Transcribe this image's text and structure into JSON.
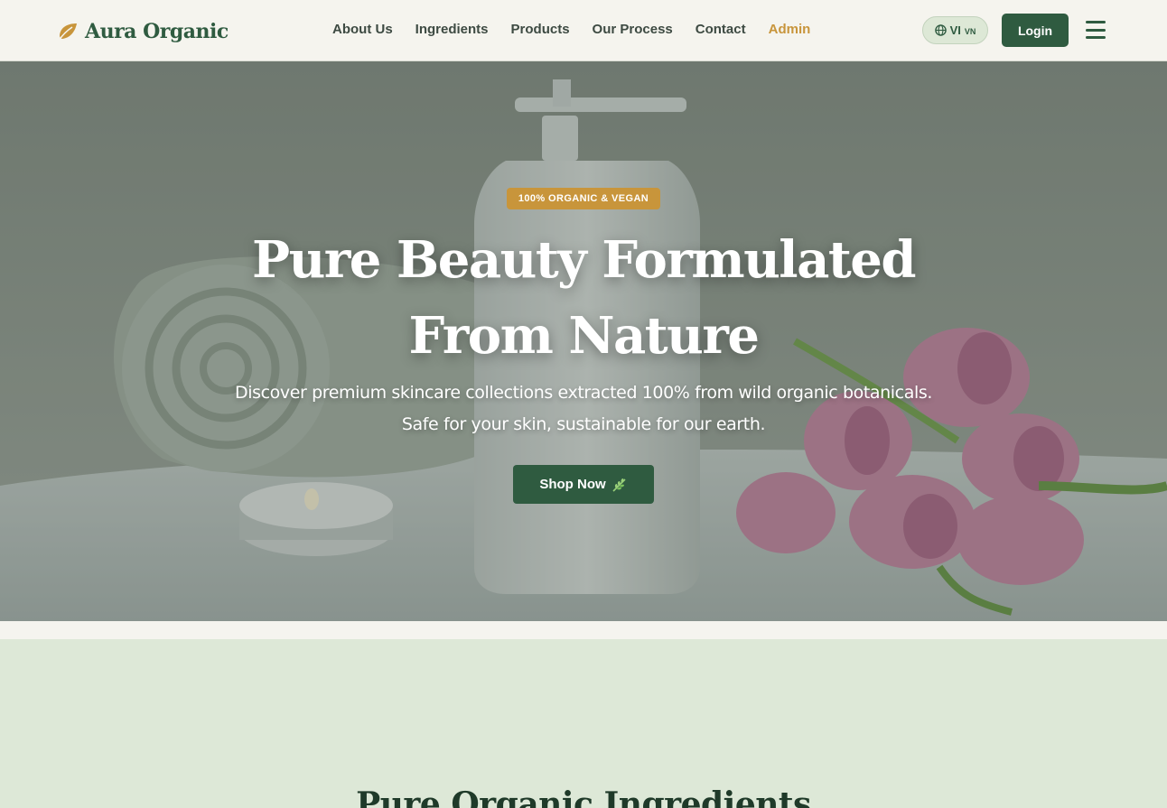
{
  "brand": {
    "name": "Aura Organic"
  },
  "nav": {
    "items": [
      {
        "label": "About Us"
      },
      {
        "label": "Ingredients"
      },
      {
        "label": "Products"
      },
      {
        "label": "Our Process"
      },
      {
        "label": "Contact"
      },
      {
        "label": "Admin"
      }
    ]
  },
  "header": {
    "lang_label": "VI",
    "lang_region": "VN",
    "login_label": "Login"
  },
  "hero": {
    "badge": "100% ORGANIC & VEGAN",
    "title": "Pure Beauty Formulated From Nature",
    "subtitle": "Discover premium skincare collections extracted 100% from wild organic botanicals. Safe for your skin, sustainable for our earth.",
    "cta_label": "Shop Now"
  },
  "section": {
    "title": "Pure Organic Ingredients"
  },
  "colors": {
    "brand_green": "#2f5b40",
    "accent_gold": "#c8953b",
    "section_bg": "#dde8d7",
    "header_bg": "#f5f4ee"
  },
  "icons": {
    "logo": "leaf-icon",
    "lang": "globe-icon",
    "menu": "hamburger-menu-icon",
    "cta": "leaf-sprig-icon"
  }
}
